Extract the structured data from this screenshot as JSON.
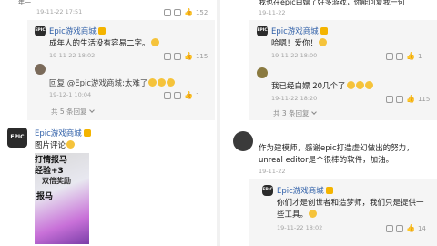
{
  "left": {
    "top_meta": "19-11-22 17:51",
    "top_snippet": "年一",
    "top_likes": "152",
    "c1": {
      "name": "Epic游戏商城",
      "text": "成年人的生活没有容易二字。",
      "meta": "19-11-22 18:02",
      "likes": "115"
    },
    "c2": {
      "name": "回复 @Epic游戏商城:太难了",
      "meta": "19-12-1 10:04",
      "likes": "1"
    },
    "c2_more": "共 5 条回复",
    "c3": {
      "name": "Epic游戏商城",
      "text": "图片评论",
      "photo_lines": [
        "打情报马",
        "经验+3",
        "双倍奖励",
        "报马"
      ]
    }
  },
  "right": {
    "top_text": "我也在epic白嫖了好多游戏，你能回复我一句",
    "top_meta": "19-11-22",
    "c1": {
      "name": "Epic游戏商城",
      "text": "哈嗯！爱你！",
      "meta": "19-11-22 18:00",
      "likes": "1"
    },
    "c2": {
      "text": "我已经白嫖 20几个了",
      "meta": "19-11-22 18:20",
      "likes": "115"
    },
    "c2_more": "共 3 条回复",
    "c3": {
      "text1": "作为建模师，感谢epic打造虚幻做出的努力，",
      "text2": "unreal editor是个很棒的软件，加油。",
      "meta": "19-11-22"
    },
    "c4": {
      "name": "Epic游戏商城",
      "text1": "你们才是创世者和造梦师，我们只是提供一",
      "text2": "些工具。",
      "meta": "19-11-22 18:02",
      "likes": "14"
    }
  },
  "colors": {
    "name_blue": "#2f5fa8",
    "badge_gold": "#f4b400",
    "meta_grey": "#a3a3a3"
  }
}
